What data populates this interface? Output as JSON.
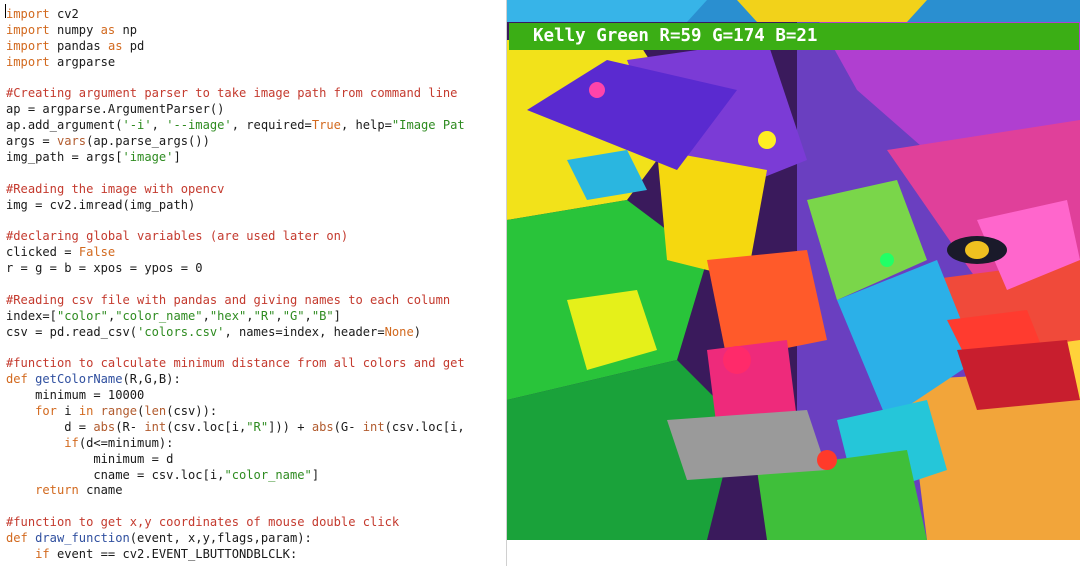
{
  "editor": {
    "lines": [
      [
        {
          "t": "import",
          "c": "kw"
        },
        {
          "t": " cv2"
        }
      ],
      [
        {
          "t": "import",
          "c": "kw"
        },
        {
          "t": " numpy "
        },
        {
          "t": "as",
          "c": "kw"
        },
        {
          "t": " np"
        }
      ],
      [
        {
          "t": "import",
          "c": "kw"
        },
        {
          "t": " pandas "
        },
        {
          "t": "as",
          "c": "kw"
        },
        {
          "t": " pd"
        }
      ],
      [
        {
          "t": "import",
          "c": "kw"
        },
        {
          "t": " argparse"
        }
      ],
      [],
      [
        {
          "t": "#Creating argument parser to take image path from command line",
          "c": "cm"
        }
      ],
      [
        {
          "t": "ap = argparse.ArgumentParser()"
        }
      ],
      [
        {
          "t": "ap.add_argument("
        },
        {
          "t": "'-i'",
          "c": "st"
        },
        {
          "t": ", "
        },
        {
          "t": "'--image'",
          "c": "st"
        },
        {
          "t": ", required="
        },
        {
          "t": "True",
          "c": "kw"
        },
        {
          "t": ", help="
        },
        {
          "t": "\"Image Pat",
          "c": "st"
        }
      ],
      [
        {
          "t": "args = "
        },
        {
          "t": "vars",
          "c": "bi"
        },
        {
          "t": "(ap.parse_args())"
        }
      ],
      [
        {
          "t": "img_path = args["
        },
        {
          "t": "'image'",
          "c": "st"
        },
        {
          "t": "]"
        }
      ],
      [],
      [
        {
          "t": "#Reading the image with opencv",
          "c": "cm"
        }
      ],
      [
        {
          "t": "img = cv2.imread(img_path)"
        }
      ],
      [],
      [
        {
          "t": "#declaring global variables (are used later on)",
          "c": "cm"
        }
      ],
      [
        {
          "t": "clicked = "
        },
        {
          "t": "False",
          "c": "kw"
        }
      ],
      [
        {
          "t": "r = g = b = xpos = ypos = 0"
        }
      ],
      [],
      [
        {
          "t": "#Reading csv file with pandas and giving names to each column",
          "c": "cm"
        }
      ],
      [
        {
          "t": "index=["
        },
        {
          "t": "\"color\"",
          "c": "st"
        },
        {
          "t": ","
        },
        {
          "t": "\"color_name\"",
          "c": "st"
        },
        {
          "t": ","
        },
        {
          "t": "\"hex\"",
          "c": "st"
        },
        {
          "t": ","
        },
        {
          "t": "\"R\"",
          "c": "st"
        },
        {
          "t": ","
        },
        {
          "t": "\"G\"",
          "c": "st"
        },
        {
          "t": ","
        },
        {
          "t": "\"B\"",
          "c": "st"
        },
        {
          "t": "]"
        }
      ],
      [
        {
          "t": "csv = pd.read_csv("
        },
        {
          "t": "'colors.csv'",
          "c": "st"
        },
        {
          "t": ", names=index, header="
        },
        {
          "t": "None",
          "c": "kw"
        },
        {
          "t": ")"
        }
      ],
      [],
      [
        {
          "t": "#function to calculate minimum distance from all colors and get",
          "c": "cm"
        }
      ],
      [
        {
          "t": "def",
          "c": "kw"
        },
        {
          "t": " "
        },
        {
          "t": "getColorName",
          "c": "fn"
        },
        {
          "t": "(R,G,B):"
        }
      ],
      [
        {
          "t": "    minimum = 10000"
        }
      ],
      [
        {
          "t": "    "
        },
        {
          "t": "for",
          "c": "kw"
        },
        {
          "t": " i "
        },
        {
          "t": "in",
          "c": "kw"
        },
        {
          "t": " "
        },
        {
          "t": "range",
          "c": "bi"
        },
        {
          "t": "("
        },
        {
          "t": "len",
          "c": "bi"
        },
        {
          "t": "(csv)):"
        }
      ],
      [
        {
          "t": "        d = "
        },
        {
          "t": "abs",
          "c": "bi"
        },
        {
          "t": "(R- "
        },
        {
          "t": "int",
          "c": "bi"
        },
        {
          "t": "(csv.loc[i,"
        },
        {
          "t": "\"R\"",
          "c": "st"
        },
        {
          "t": "])) + "
        },
        {
          "t": "abs",
          "c": "bi"
        },
        {
          "t": "(G- "
        },
        {
          "t": "int",
          "c": "bi"
        },
        {
          "t": "(csv.loc[i,"
        }
      ],
      [
        {
          "t": "        "
        },
        {
          "t": "if",
          "c": "kw"
        },
        {
          "t": "(d<=minimum):"
        }
      ],
      [
        {
          "t": "            minimum = d"
        }
      ],
      [
        {
          "t": "            cname = csv.loc[i,"
        },
        {
          "t": "\"color_name\"",
          "c": "st"
        },
        {
          "t": "]"
        }
      ],
      [
        {
          "t": "    "
        },
        {
          "t": "return",
          "c": "kw"
        },
        {
          "t": " cname"
        }
      ],
      [],
      [
        {
          "t": "#function to get x,y coordinates of mouse double click",
          "c": "cm"
        }
      ],
      [
        {
          "t": "def",
          "c": "kw"
        },
        {
          "t": " "
        },
        {
          "t": "draw_function",
          "c": "fn"
        },
        {
          "t": "(event, x,y,flags,param):"
        }
      ],
      [
        {
          "t": "    "
        },
        {
          "t": "if",
          "c": "kw"
        },
        {
          "t": " event == cv2.EVENT_LBUTTONDBLCLK:"
        }
      ]
    ]
  },
  "viewer": {
    "color_label": "Kelly Green R=59 G=174 B=21",
    "banner_color": "#3bae15",
    "image_subject": "colorful-pop-art-lion"
  }
}
